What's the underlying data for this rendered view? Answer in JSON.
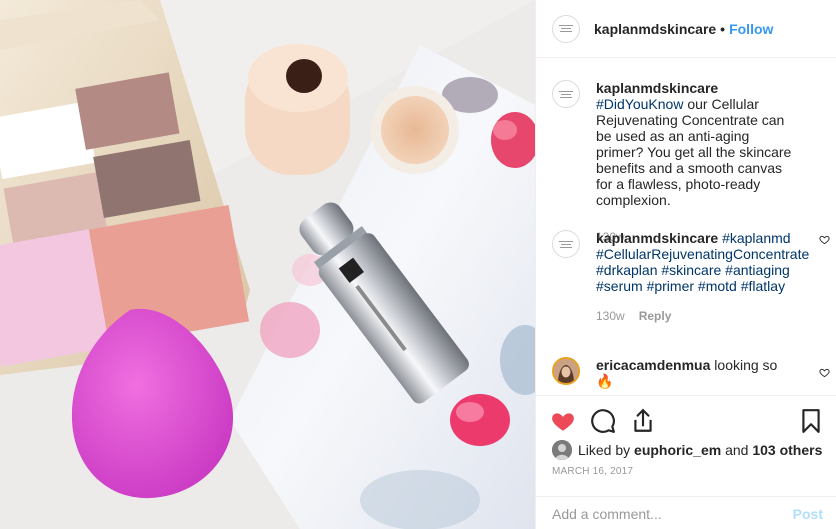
{
  "header": {
    "username": "kaplanmdskincare",
    "separator": "•",
    "follow_label": "Follow"
  },
  "caption": {
    "username": "kaplanmdskincare",
    "hashtag": "#DidYouKnow",
    "text": "our Cellular Rejuvenating Concentrate can be used as an anti-aging primer? You get all the skincare benefits and a smooth canvas for a flawless, photo-ready complexion.",
    "time": "130w"
  },
  "comments": [
    {
      "username": "kaplanmdskincare",
      "text": "#kaplanmd #CellularRejuvenatingConcentrate #drkaplan #skincare #antiaging #serum #primer #motd #flatlay",
      "time": "130w",
      "reply_label": "Reply"
    },
    {
      "username": "ericacamdenmua",
      "text": "looking so 🔥"
    }
  ],
  "actions": {
    "like_icon": "heart-filled-icon",
    "comment_icon": "comment-icon",
    "share_icon": "share-icon",
    "save_icon": "bookmark-icon"
  },
  "likes": {
    "prefix": "Liked by",
    "user": "euphoric_em",
    "and": "and",
    "others": "103 others"
  },
  "date": "March 16, 2017",
  "add_comment": {
    "placeholder": "Add a comment...",
    "post_label": "Post"
  },
  "colors": {
    "accent": "#3897f0",
    "like_red": "#ed4956",
    "hashtag": "#003569",
    "muted": "#999999"
  }
}
